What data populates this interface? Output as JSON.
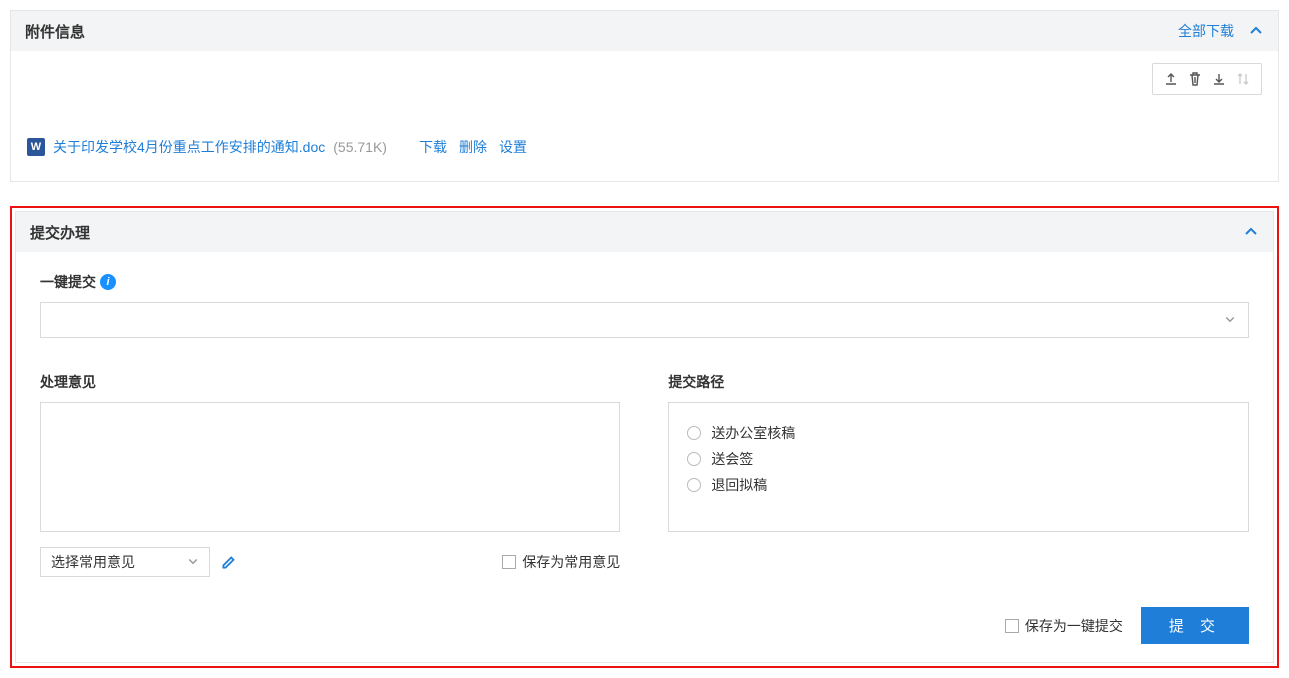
{
  "attachment_panel": {
    "title": "附件信息",
    "download_all": "全部下载",
    "toolbar": {
      "upload": "upload",
      "delete": "delete",
      "download": "download",
      "sort": "sort"
    },
    "file": {
      "name": "关于印发学校4月份重点工作安排的通知.doc",
      "size": "(55.71K)",
      "actions": {
        "download": "下载",
        "delete": "删除",
        "settings": "设置"
      }
    }
  },
  "submit_panel": {
    "title": "提交办理",
    "one_click": {
      "label": "一键提交"
    },
    "opinion": {
      "label": "处理意见",
      "common_select": "选择常用意见",
      "save_common": "保存为常用意见"
    },
    "path": {
      "label": "提交路径",
      "options": [
        "送办公室核稿",
        "送会签",
        "退回拟稿"
      ]
    },
    "footer": {
      "save_one_click": "保存为一键提交",
      "submit": "提 交"
    }
  }
}
